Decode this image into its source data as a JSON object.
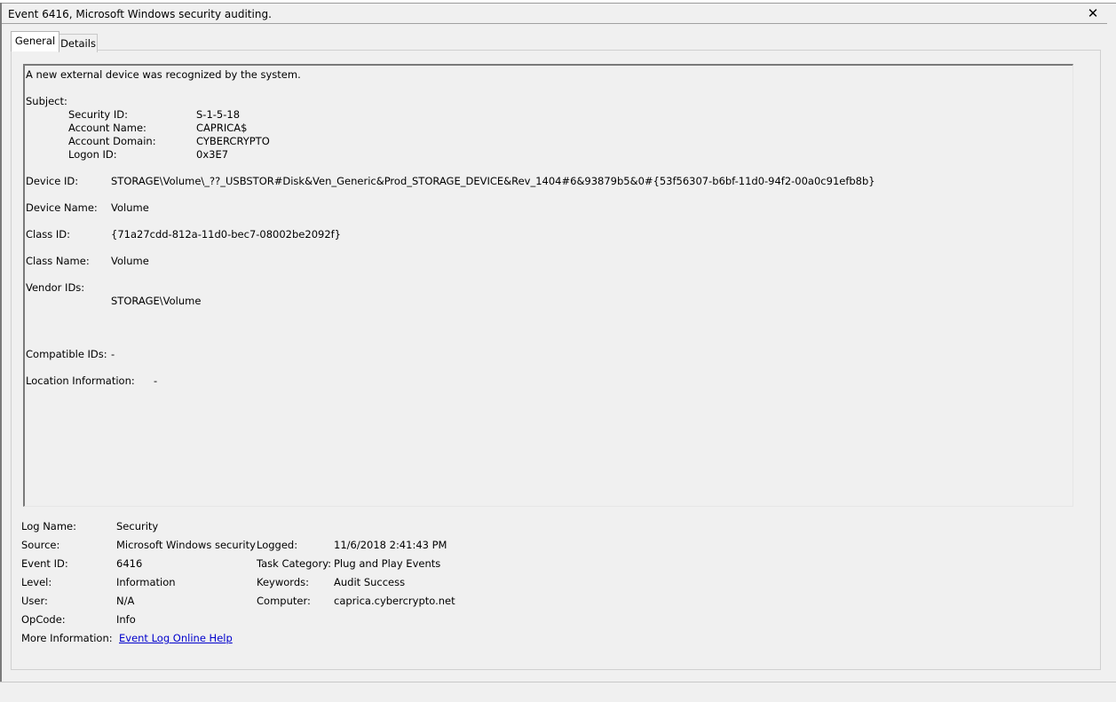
{
  "window": {
    "title": "Event 6416, Microsoft Windows security auditing.",
    "close_glyph": "✕"
  },
  "tabs": [
    {
      "label": "General"
    },
    {
      "label": "Details"
    }
  ],
  "message": {
    "intro": "A new external device was recognized by the system.",
    "subject_label": "Subject:",
    "subject": [
      {
        "label": "Security ID:",
        "value": "S-1-5-18"
      },
      {
        "label": "Account Name:",
        "value": "CAPRICA$"
      },
      {
        "label": "Account Domain:",
        "value": "CYBERCRYPTO"
      },
      {
        "label": "Logon ID:",
        "value": "0x3E7"
      }
    ],
    "device_id": {
      "label": "Device ID:",
      "value": "STORAGE\\Volume\\_??_USBSTOR#Disk&Ven_Generic&Prod_STORAGE_DEVICE&Rev_1404#6&93879b5&0#{53f56307-b6bf-11d0-94f2-00a0c91efb8b}"
    },
    "device_name": {
      "label": "Device Name:",
      "value": "Volume"
    },
    "class_id": {
      "label": "Class ID:",
      "value": "{71a27cdd-812a-11d0-bec7-08002be2092f}"
    },
    "class_name": {
      "label": "Class Name:",
      "value": "Volume"
    },
    "vendor_ids": {
      "label": "Vendor IDs:",
      "value": "STORAGE\\Volume"
    },
    "compatible_ids": {
      "label": "Compatible IDs:",
      "value": "-"
    },
    "location_info": {
      "label": "Location Information:",
      "value": "-"
    }
  },
  "details": {
    "log_name": {
      "label": "Log Name:",
      "value": "Security"
    },
    "source": {
      "label": "Source:",
      "value": "Microsoft Windows security"
    },
    "logged": {
      "label": "Logged:",
      "value": "11/6/2018 2:41:43 PM"
    },
    "event_id": {
      "label": "Event ID:",
      "value": "6416"
    },
    "task_category": {
      "label": "Task Category:",
      "value": "Plug and Play Events"
    },
    "level": {
      "label": "Level:",
      "value": "Information"
    },
    "keywords": {
      "label": "Keywords:",
      "value": "Audit Success"
    },
    "user": {
      "label": "User:",
      "value": "N/A"
    },
    "computer": {
      "label": "Computer:",
      "value": "caprica.cybercrypto.net"
    },
    "opcode": {
      "label": "OpCode:",
      "value": "Info"
    },
    "more_info": {
      "label": "More Information:",
      "link": "Event Log Online Help"
    }
  }
}
